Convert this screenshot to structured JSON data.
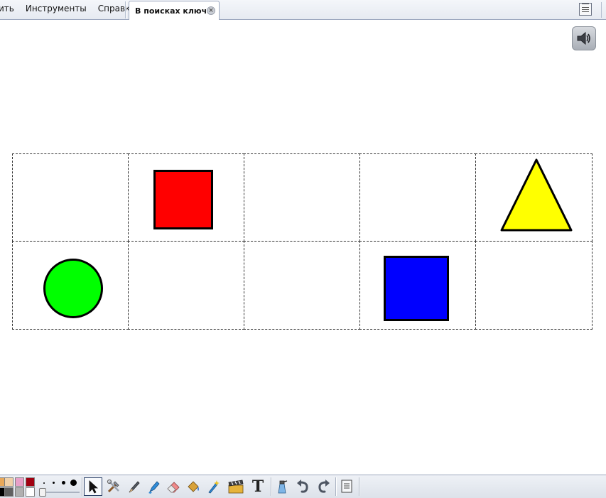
{
  "menu": {
    "items": [
      {
        "label": "ить"
      },
      {
        "label": "Инструменты"
      },
      {
        "label": "Справка"
      }
    ]
  },
  "tab": {
    "title": "В поисках ключа",
    "close_icon": "close-icon"
  },
  "sound_button": {
    "icon": "speaker-icon"
  },
  "grid": {
    "rows": 2,
    "columns": 5,
    "cells": [
      {
        "row": 1,
        "col": 1,
        "shape": null
      },
      {
        "row": 1,
        "col": 2,
        "shape": "square",
        "color": "#ff0000"
      },
      {
        "row": 1,
        "col": 3,
        "shape": null
      },
      {
        "row": 1,
        "col": 4,
        "shape": null
      },
      {
        "row": 1,
        "col": 5,
        "shape": "triangle",
        "color": "#ffff00"
      },
      {
        "row": 2,
        "col": 1,
        "shape": "circle",
        "color": "#00ff00"
      },
      {
        "row": 2,
        "col": 2,
        "shape": null
      },
      {
        "row": 2,
        "col": 3,
        "shape": null
      },
      {
        "row": 2,
        "col": 4,
        "shape": "square",
        "color": "#0000ff"
      },
      {
        "row": 2,
        "col": 5,
        "shape": null
      }
    ]
  },
  "toolbar": {
    "palette_top": [
      "#e8a85a",
      "#f0d0a8",
      "#e8a0c8",
      "#a00010"
    ],
    "palette_bottom": [
      "#000000",
      "#606060",
      "#b0b0b0",
      "#ffffff"
    ],
    "pen_sizes": [
      "smallest",
      "small",
      "medium",
      "large"
    ],
    "tools": [
      "select-arrow-icon",
      "tools-icon",
      "pen-icon",
      "highlighter-icon",
      "eraser-icon",
      "fill-bucket-icon",
      "magic-pen-icon",
      "clapboard-icon",
      "text-icon",
      "spray-cleaner-icon",
      "undo-icon",
      "redo-icon",
      "page-list-icon"
    ],
    "text_tool_label": "T",
    "colors": {
      "accent_border": "#2a3f66"
    }
  }
}
